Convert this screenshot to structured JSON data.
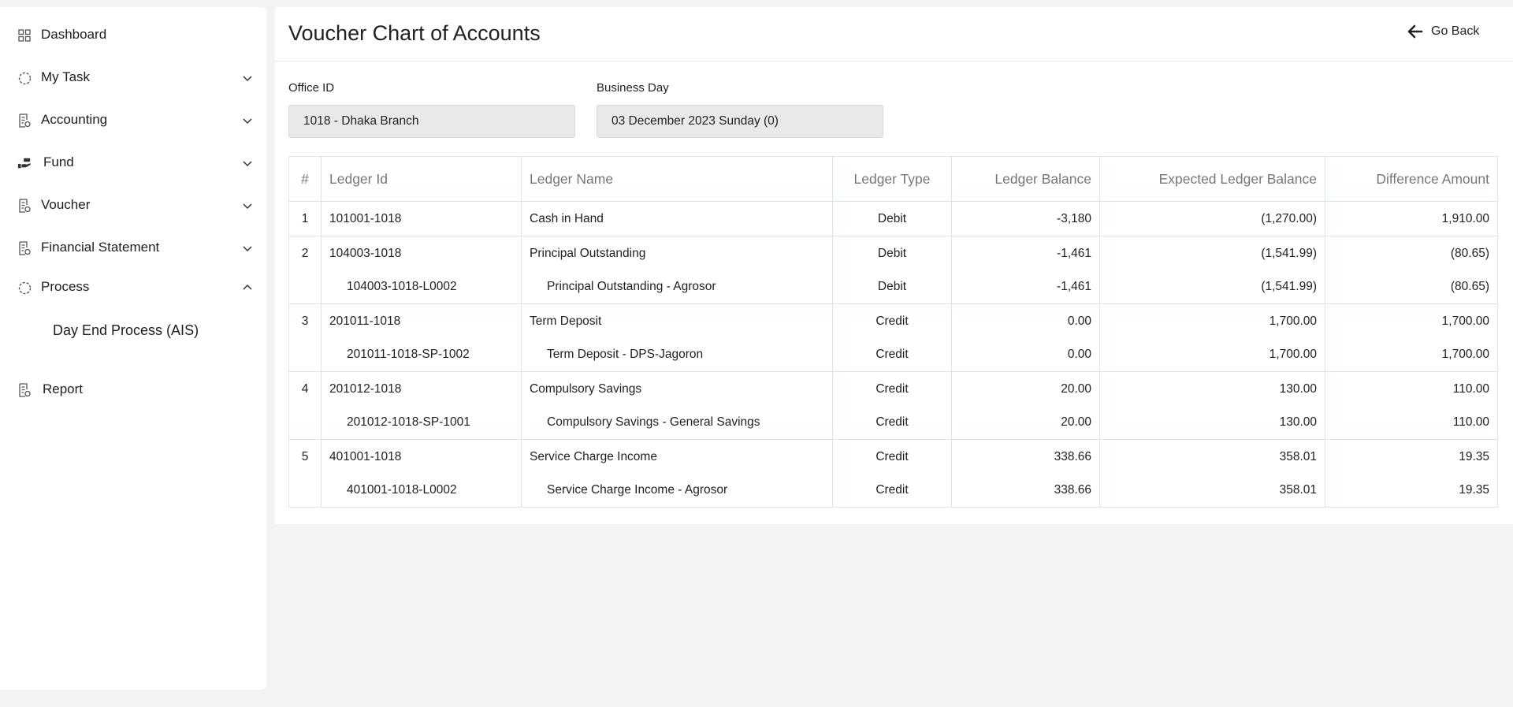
{
  "sidebar": {
    "items": [
      {
        "label": "Dashboard",
        "icon": "grid-icon"
      },
      {
        "label": "My Task",
        "icon": "dashed-circle-icon"
      },
      {
        "label": "Accounting",
        "icon": "document-icon"
      },
      {
        "label": "Fund",
        "icon": "hand-money-icon"
      },
      {
        "label": "Voucher",
        "icon": "document-icon"
      },
      {
        "label": "Financial Statement",
        "icon": "document-icon"
      },
      {
        "label": "Process",
        "icon": "dashed-circle-icon"
      },
      {
        "label": "Report",
        "icon": "document-icon"
      }
    ],
    "process_sub": "Day End Process (AIS)"
  },
  "header": {
    "title": "Voucher Chart of Accounts",
    "go_back": "Go Back"
  },
  "form": {
    "office_label": "Office ID",
    "office_value": "1018 - Dhaka Branch",
    "day_label": "Business Day",
    "day_value": "03 December 2023 Sunday (0)"
  },
  "table": {
    "columns": [
      "#",
      "Ledger Id",
      "Ledger Name",
      "Ledger Type",
      "Ledger Balance",
      "Expected Ledger Balance",
      "Difference Amount"
    ],
    "rows": [
      {
        "num": "1",
        "id": "101001-1018",
        "name": "Cash in Hand",
        "type": "Debit",
        "balance": "-3,180",
        "expected": "(1,270.00)",
        "diff": "1,910.00"
      },
      {
        "num": "2",
        "id": "104003-1018",
        "name": "Principal Outstanding",
        "type": "Debit",
        "balance": "-1,461",
        "expected": "(1,541.99)",
        "diff": "(80.65)"
      },
      {
        "num": "",
        "id": "104003-1018-L0002",
        "name": "Principal Outstanding - Agrosor",
        "type": "Debit",
        "balance": "-1,461",
        "expected": "(1,541.99)",
        "diff": "(80.65)"
      },
      {
        "num": "3",
        "id": "201011-1018",
        "name": "Term Deposit",
        "type": "Credit",
        "balance": "0.00",
        "expected": "1,700.00",
        "diff": "1,700.00"
      },
      {
        "num": "",
        "id": "201011-1018-SP-1002",
        "name": "Term Deposit - DPS-Jagoron",
        "type": "Credit",
        "balance": "0.00",
        "expected": "1,700.00",
        "diff": "1,700.00"
      },
      {
        "num": "4",
        "id": "201012-1018",
        "name": "Compulsory Savings",
        "type": "Credit",
        "balance": "20.00",
        "expected": "130.00",
        "diff": "110.00"
      },
      {
        "num": "",
        "id": "201012-1018-SP-1001",
        "name": "Compulsory Savings - General Savings",
        "type": "Credit",
        "balance": "20.00",
        "expected": "130.00",
        "diff": "110.00"
      },
      {
        "num": "5",
        "id": "401001-1018",
        "name": "Service Charge Income",
        "type": "Credit",
        "balance": "338.66",
        "expected": "358.01",
        "diff": "19.35"
      },
      {
        "num": "",
        "id": "401001-1018-L0002",
        "name": "Service Charge Income - Agrosor",
        "type": "Credit",
        "balance": "338.66",
        "expected": "358.01",
        "diff": "19.35"
      }
    ]
  },
  "colors": {
    "negative": "#e0393e",
    "header_text": "#777777",
    "border": "#d7e6e6"
  }
}
